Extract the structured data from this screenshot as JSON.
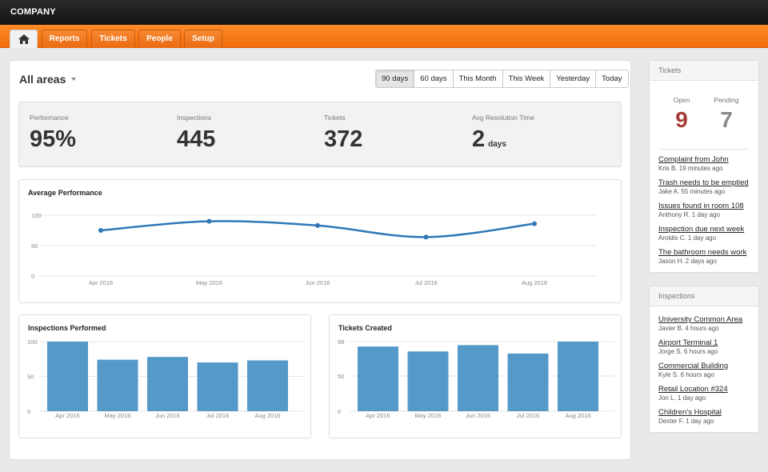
{
  "brand": "COMPANY",
  "nav": {
    "tabs": [
      {
        "label": ""
      },
      {
        "label": "Reports"
      },
      {
        "label": "Tickets"
      },
      {
        "label": "People"
      },
      {
        "label": "Setup"
      }
    ]
  },
  "header": {
    "title": "All areas",
    "ranges": [
      "90 days",
      "60 days",
      "This Month",
      "This Week",
      "Yesterday",
      "Today"
    ],
    "active_range": "90 days"
  },
  "stats": [
    {
      "label": "Performance",
      "value": "95%",
      "unit": ""
    },
    {
      "label": "Inspections",
      "value": "445",
      "unit": ""
    },
    {
      "label": "Tickets",
      "value": "372",
      "unit": ""
    },
    {
      "label": "Avg Resolution Time",
      "value": "2",
      "unit": "days"
    }
  ],
  "colors": {
    "accent": "#f47a1f",
    "series": "#2e78b7",
    "bar": "#5599c9",
    "open": "#a63a35",
    "pending": "#888888"
  },
  "chart_data": [
    {
      "type": "line",
      "title": "Average Performance",
      "categories": [
        "Apr 2016",
        "May 2016",
        "Jun 2016",
        "Jul 2016",
        "Aug 2016"
      ],
      "values": [
        75,
        90,
        83,
        64,
        86
      ],
      "yticks": [
        0,
        50,
        100
      ],
      "ylim": [
        0,
        100
      ],
      "grid": true
    },
    {
      "type": "bar",
      "title": "Inspections Performed",
      "categories": [
        "Apr 2016",
        "May 2016",
        "Jun 2016",
        "Jul 2016",
        "Aug 2016"
      ],
      "values": [
        100,
        74,
        78,
        70,
        73
      ],
      "yticks": [
        0,
        50,
        100
      ],
      "ylim": [
        0,
        100
      ],
      "grid": true
    },
    {
      "type": "bar",
      "title": "Tickets Created",
      "categories": [
        "Apr 2016",
        "May 2016",
        "Jun 2016",
        "Jul 2016",
        "Aug 2016"
      ],
      "values": [
        92,
        85,
        94,
        82,
        99
      ],
      "yticks": [
        0,
        50,
        99
      ],
      "ylim": [
        0,
        99
      ],
      "grid": true
    }
  ],
  "tickets_panel": {
    "heading": "Tickets",
    "open_label": "Open",
    "open_count": "9",
    "pending_label": "Pending",
    "pending_count": "7",
    "items": [
      {
        "title": "Complaint from John",
        "meta": "Kris B. 19 minutes ago"
      },
      {
        "title": "Trash needs to be emptied",
        "meta": "Jake A. 55 minutes ago"
      },
      {
        "title": "Issues found in room 108",
        "meta": "Anthony R. 1 day ago"
      },
      {
        "title": "Inspection due next week",
        "meta": "Aroldis C. 1 day ago"
      },
      {
        "title": "The bathroom needs work",
        "meta": "Jason H. 2 days ago"
      }
    ]
  },
  "inspections_panel": {
    "heading": "Inspections",
    "items": [
      {
        "title": "University Common Area",
        "meta": "Javier B. 4 hours ago"
      },
      {
        "title": "Airport Terminal 1",
        "meta": "Jorge S. 6 hours ago"
      },
      {
        "title": "Commercial Building",
        "meta": "Kyle S. 6 hours ago"
      },
      {
        "title": "Retail Location #324",
        "meta": "Jon L. 1 day ago"
      },
      {
        "title": "Children's Hospital",
        "meta": "Dexter F. 1 day ago"
      }
    ]
  }
}
